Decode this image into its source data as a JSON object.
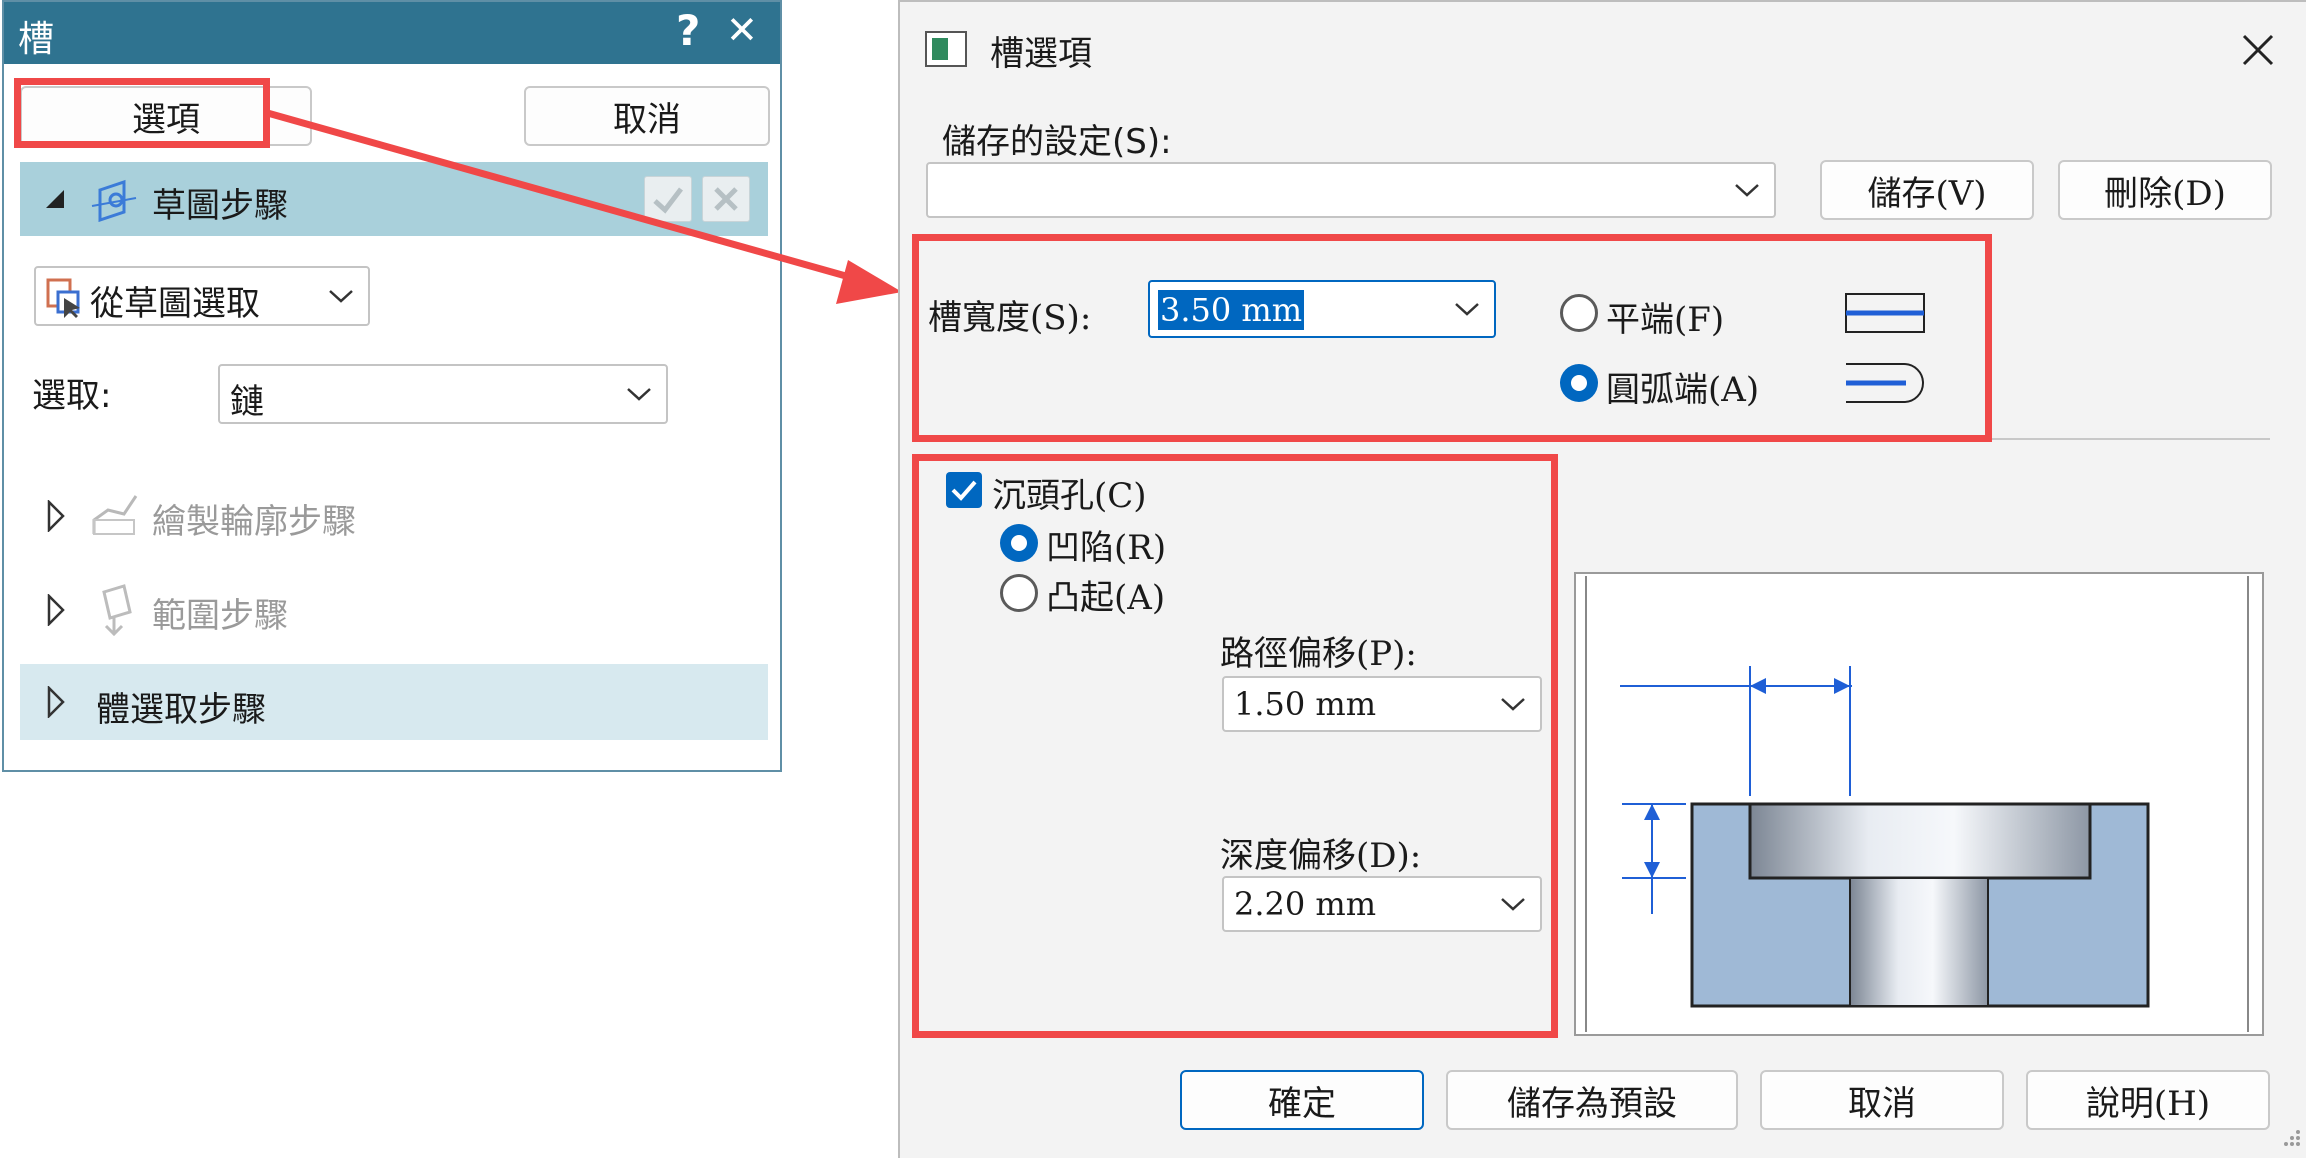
{
  "left_panel": {
    "title": "槽",
    "help_glyph": "?",
    "close_glyph": "✕",
    "options_button": "選項",
    "cancel_button": "取消",
    "sketch_step": "草圖步驟",
    "from_sketch_select": "從草圖選取",
    "select_label": "選取:",
    "select_value": "鏈",
    "draw_profile_step": "繪製輪廓步驟",
    "extent_step": "範圍步驟",
    "body_select_step": "體選取步驟"
  },
  "dialog": {
    "title": "槽選項",
    "saved_settings_label": "儲存的設定(S):",
    "saved_settings_value": "",
    "save_button": "儲存(V)",
    "delete_button": "刪除(D)",
    "slot_width_label": "槽寬度(S):",
    "slot_width_value": "3.50 mm",
    "flat_end_label": "平端(F)",
    "arc_end_label": "圓弧端(A)",
    "end_type_selected": "arc",
    "counterbore_label": "沉頭孔(C)",
    "counterbore_checked": true,
    "recessed_label": "凹陷(R)",
    "raised_label": "凸起(A)",
    "counterbore_type_selected": "recessed",
    "path_offset_label": "路徑偏移(P):",
    "path_offset_value": "1.50 mm",
    "depth_offset_label": "深度偏移(D):",
    "depth_offset_value": "2.20 mm",
    "ok_button": "確定",
    "save_default_button": "儲存為預設",
    "cancel_button": "取消",
    "help_button": "說明(H)"
  },
  "colors": {
    "panel_titlebar": "#2f7390",
    "step_highlight": "#a9d0db",
    "step_light": "#d7e9ef",
    "annotation_red": "#f04848",
    "accent_blue": "#0067c0",
    "diagram_blue": "#1f5fd6",
    "body_fill": "#9fb9d6"
  },
  "icons": [
    "help-icon",
    "close-icon",
    "collapse-triangle-icon",
    "expand-triangle-icon",
    "sketch-step-icon",
    "profile-step-icon",
    "extent-step-icon",
    "sketch-select-icon",
    "check-icon",
    "x-icon",
    "chevron-down-icon",
    "dialog-app-icon"
  ]
}
